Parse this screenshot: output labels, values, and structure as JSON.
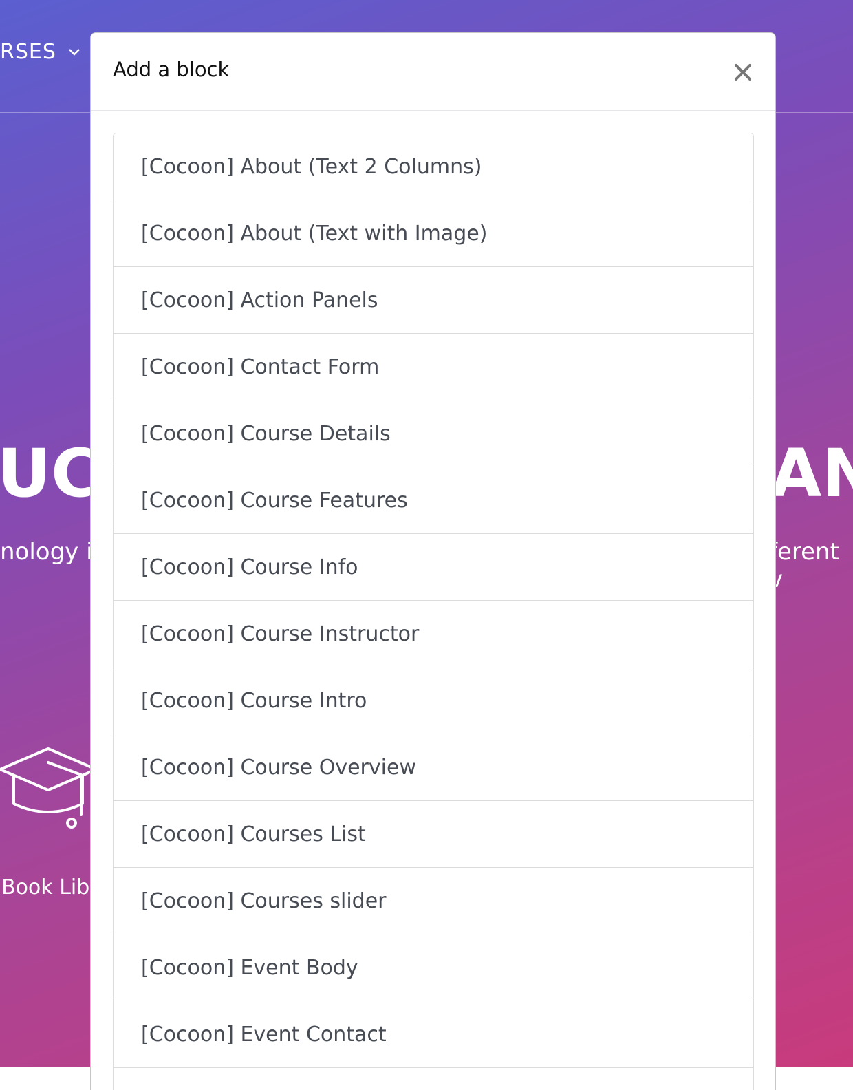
{
  "background": {
    "nav_text": "RSES",
    "hero_title_left": "UC",
    "hero_title_right": "AN",
    "hero_sub_left": "nology is",
    "hero_sub_right": "ferent v",
    "feature_label": "Book Libr",
    "gradient_colors": [
      "#5b5fd0",
      "#7d4cb8",
      "#a84597",
      "#c83b7c"
    ]
  },
  "modal": {
    "title": "Add a block",
    "close_icon": "close-icon",
    "items": [
      {
        "label": "[Cocoon] About (Text 2 Columns)"
      },
      {
        "label": "[Cocoon] About (Text with Image)"
      },
      {
        "label": "[Cocoon] Action Panels"
      },
      {
        "label": "[Cocoon] Contact Form"
      },
      {
        "label": "[Cocoon] Course Details"
      },
      {
        "label": "[Cocoon] Course Features"
      },
      {
        "label": "[Cocoon] Course Info"
      },
      {
        "label": "[Cocoon] Course Instructor"
      },
      {
        "label": "[Cocoon] Course Intro"
      },
      {
        "label": "[Cocoon] Course Overview"
      },
      {
        "label": "[Cocoon] Courses List"
      },
      {
        "label": "[Cocoon] Courses slider"
      },
      {
        "label": "[Cocoon] Event Body"
      },
      {
        "label": "[Cocoon] Event Contact"
      },
      {
        "label": ""
      }
    ]
  }
}
